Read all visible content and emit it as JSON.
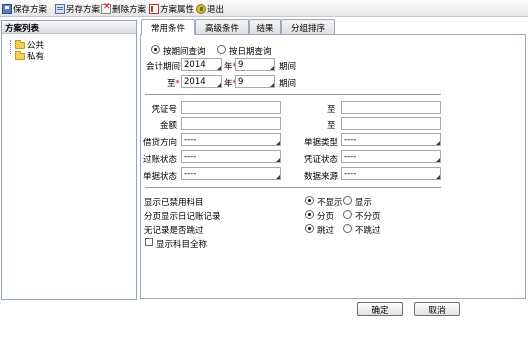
{
  "toolbar": {
    "save": "保存方案",
    "save_as": "另存方案",
    "delete": "删除方案",
    "properties": "方案属性",
    "exit": "退出"
  },
  "left": {
    "title": "方案列表",
    "items": [
      "公共",
      "私有"
    ]
  },
  "tabs": [
    "常用条件",
    "高级条件",
    "结果",
    "分组排序"
  ],
  "query_mode": {
    "by_period": "按期间查询",
    "by_date": "按日期查询",
    "selected": "by_period"
  },
  "period": {
    "label": "会计期间",
    "to_label": "至",
    "year_unit": "年",
    "period_unit": "期间",
    "from_year": "2014",
    "from_period": "9",
    "to_year": "2014",
    "to_period": "9"
  },
  "filters": {
    "voucher_no": "凭证号",
    "amount": "金额",
    "to": "至",
    "debit_credit": "借贷方向",
    "debit_credit_value": "----",
    "doc_type": "单据类型",
    "doc_type_value": "----",
    "posting_status": "过账状态",
    "posting_status_value": "----",
    "voucher_status": "凭证状态",
    "voucher_status_value": "----",
    "doc_status": "单据状态",
    "doc_status_value": "----",
    "data_source": "数据来源",
    "data_source_value": "----"
  },
  "options": {
    "show_disabled": "显示已禁用科目",
    "show_disabled_no": "不显示",
    "show_disabled_yes": "显示",
    "paging": "分页显示日记账记录",
    "paging_yes": "分页",
    "paging_no": "不分页",
    "skip_empty": "无记录是否跳过",
    "skip_yes": "跳过",
    "skip_no": "不跳过",
    "full_name": "显示科目全称"
  },
  "buttons": {
    "ok": "确定",
    "cancel": "取消"
  }
}
